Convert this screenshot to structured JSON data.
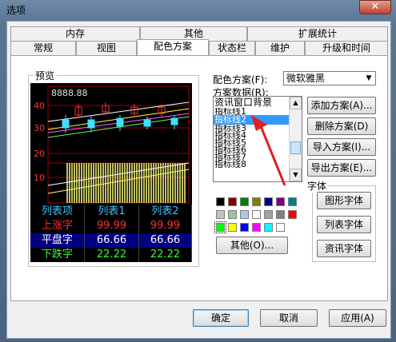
{
  "window": {
    "title": "选项",
    "close_glyph": "✕"
  },
  "tabs_top": [
    "内存",
    "其他",
    "扩展统计"
  ],
  "tabs_bottom": [
    "常规",
    "视图",
    "配色方案",
    "状态栏",
    "维护",
    "升级和时间"
  ],
  "active_tab": "配色方案",
  "preview": {
    "group_label": "预览",
    "price_label": "8888.88",
    "y_ticks": [
      "40",
      "30",
      "20",
      "10"
    ],
    "table": {
      "headers": [
        "列表项",
        "列表1",
        "列表2"
      ],
      "rows": [
        {
          "label": "上涨字",
          "v1": "99.99",
          "v2": "99.99"
        },
        {
          "label": "平盘字",
          "v1": "66.66",
          "v2": "66.66"
        },
        {
          "label": "下跌字",
          "v1": "22.22",
          "v2": "22.22"
        }
      ]
    },
    "colors": {
      "bg": "#000000",
      "grid": "#a00000",
      "up": "#ff3030",
      "flat": "#ffffff",
      "down": "#30ff30",
      "header": "#40c0ff",
      "volume": "#ffff80"
    }
  },
  "scheme": {
    "label": "配色方案(F):",
    "selected": "微软雅黑",
    "data_label": "方案数据(R):",
    "items": [
      "资讯窗口背景",
      "指标线1",
      "指标线2",
      "指标线3",
      "指标线4",
      "指标线5",
      "指标线6",
      "指标线7",
      "指标线8"
    ],
    "selected_index": 2
  },
  "scheme_buttons": [
    "添加方案(A)...",
    "删除方案(D)",
    "导入方案(I)...",
    "导出方案(E)..."
  ],
  "palette": {
    "rows": [
      [
        "#000000",
        "#800000",
        "#008000",
        "#808000",
        "#000080",
        "#800080",
        "#008080"
      ],
      [
        "#c0c0c0",
        "#a0c0a0",
        "#a6caf0",
        "#fffbf0",
        "#a0a0a4",
        "#808080",
        "#ff0000"
      ],
      [
        "#00ff00",
        "#ffff00",
        "#0000ff",
        "#ff00ff",
        "#00ffff",
        "#ffffff"
      ]
    ],
    "selected": "#00ff00",
    "other_button": "其他(O)..."
  },
  "font_group": {
    "label": "字体",
    "buttons": [
      "图形字体",
      "列表字体",
      "资讯字体"
    ]
  },
  "footer": {
    "ok": "确定",
    "cancel": "取消",
    "apply": "应用(A)"
  }
}
